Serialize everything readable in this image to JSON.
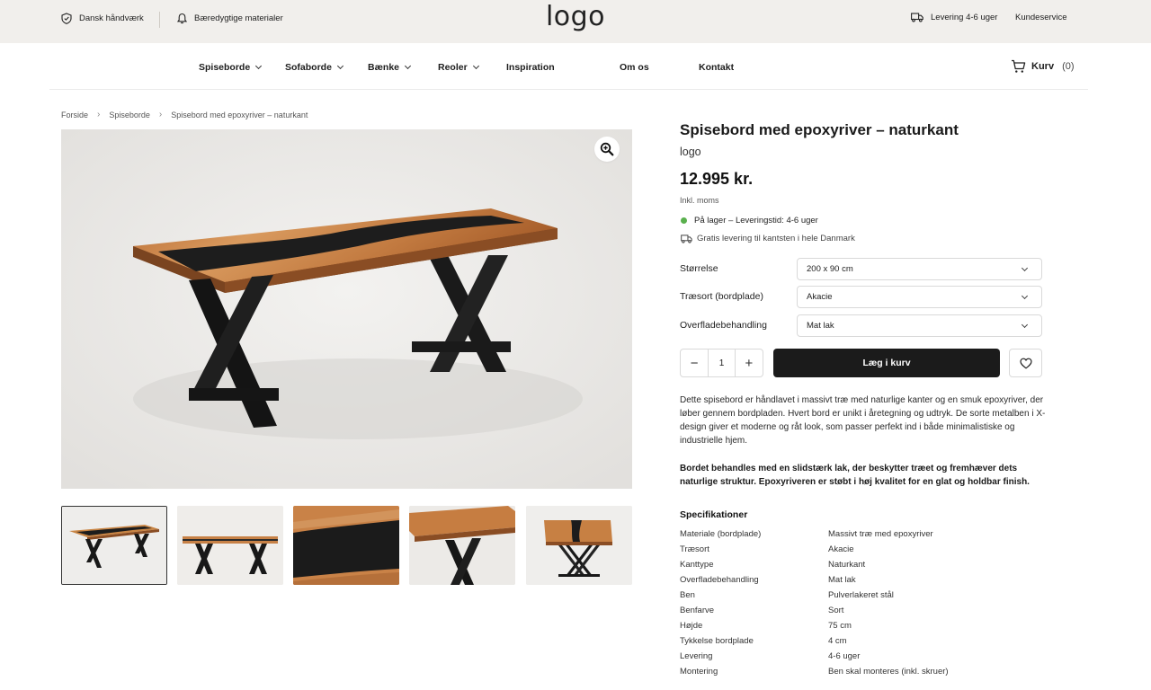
{
  "topbar": {
    "left_items": [
      {
        "label": "Dansk håndværk",
        "icon": "shield-check-icon"
      },
      {
        "label": "Bæredygtige materialer",
        "icon": "bell-icon"
      }
    ],
    "logo": "logo",
    "right_items": [
      {
        "label": "Levering 4-6 uger",
        "icon": "truck-icon"
      },
      {
        "label": "Kundeservice"
      }
    ]
  },
  "nav": {
    "items": [
      {
        "label": "Spiseborde",
        "has_dropdown": true
      },
      {
        "label": "Sofaborde",
        "has_dropdown": true
      },
      {
        "label": "Bænke",
        "has_dropdown": true
      },
      {
        "label": "Reoler",
        "has_dropdown": true
      },
      {
        "label": "Inspiration",
        "has_dropdown": false
      },
      {
        "label": "Om os",
        "has_dropdown": false
      },
      {
        "label": "Kontakt",
        "has_dropdown": false
      }
    ],
    "cart_label": "Kurv",
    "cart_count": "(0)"
  },
  "breadcrumb": [
    "Forside",
    "Spiseborde",
    "Spisebord med epoxyriver – naturkant"
  ],
  "gallery": {
    "thumb_count": 5,
    "active_index": 0
  },
  "product": {
    "title": "Spisebord med epoxyriver – naturkant",
    "brand": "logo",
    "price": "12.995 kr.",
    "vat_note": "Inkl. moms",
    "stock": "På lager – Leveringstid: 4-6 uger",
    "shipping": "Gratis levering til kantsten i hele Danmark",
    "options": [
      {
        "label": "Størrelse",
        "value": "200 x 90 cm"
      },
      {
        "label": "Træsort (bordplade)",
        "value": "Akacie"
      },
      {
        "label": "Overfladebehandling",
        "value": "Mat lak"
      }
    ],
    "quantity": "1",
    "qty_minus": "−",
    "qty_plus": "+",
    "add_to_cart": "Læg i kurv",
    "description_1": "Dette spisebord er håndlavet i massivt træ med naturlige kanter og en smuk epoxyriver, der løber gennem bordpladen. Hvert bord er unikt i åretegning og udtryk. De sorte metalben i X-design giver et moderne og råt look, som passer perfekt ind i både minimalistiske og industrielle hjem.",
    "description_2": "Bordet behandles med en slidstærk lak, der beskytter træet og fremhæver dets naturlige struktur. Epoxyriveren er støbt i høj kvalitet for en glat og holdbar finish.",
    "spec_title": "Specifikationer",
    "specs": [
      {
        "key": "Materiale (bordplade)",
        "value": "Massivt træ med epoxyriver"
      },
      {
        "key": "Træsort",
        "value": "Akacie"
      },
      {
        "key": "Kanttype",
        "value": "Naturkant"
      },
      {
        "key": "Overfladebehandling",
        "value": "Mat lak"
      },
      {
        "key": "Ben",
        "value": "Pulverlakeret stål"
      },
      {
        "key": "Benfarve",
        "value": "Sort"
      },
      {
        "key": "Højde",
        "value": "75 cm"
      },
      {
        "key": "Tykkelse bordplade",
        "value": "4 cm"
      },
      {
        "key": "Levering",
        "value": "4-6 uger"
      },
      {
        "key": "Montering",
        "value": "Ben skal monteres (inkl. skruer)"
      }
    ]
  },
  "colors": {
    "topbar_bg": "#f1efec",
    "button_dark": "#1b1b1b",
    "stock_green": "#59b04d",
    "wood": "#c07a3e",
    "resin": "#1c1c1c"
  }
}
